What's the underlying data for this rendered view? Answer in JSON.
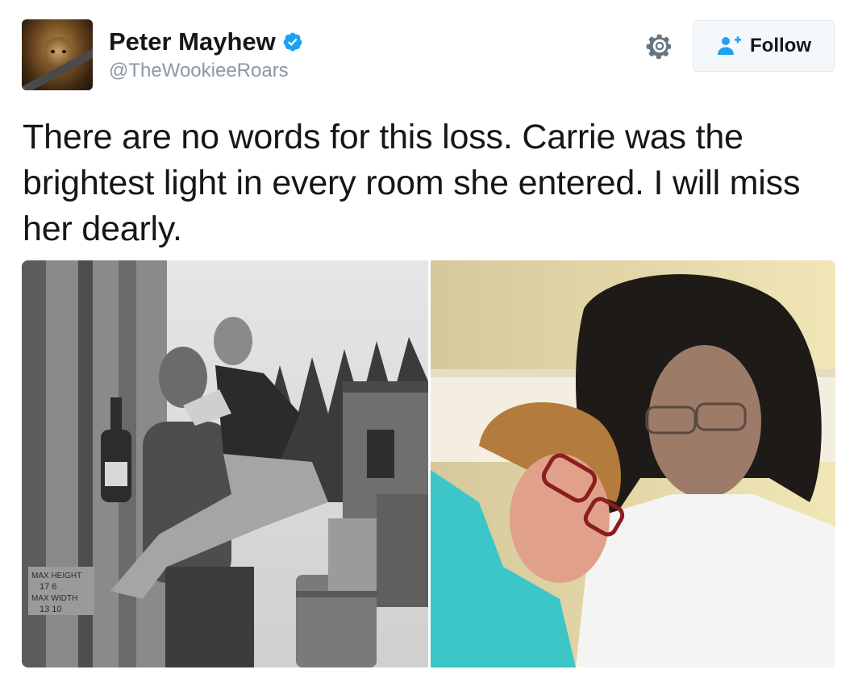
{
  "author": {
    "name": "Peter Mayhew",
    "handle": "@TheWookieeRoars",
    "verified": true
  },
  "actions": {
    "follow_label": "Follow",
    "settings_icon": "gear-icon",
    "follow_icon": "add-user-icon"
  },
  "tweet": {
    "text": "There are no words for this loss. Carrie was the brightest light in every room she entered. I will miss her dearly."
  },
  "photos": {
    "left_sign_lines": [
      "MAX HEIGHT",
      "17  6",
      "MAX WIDTH",
      "13  10"
    ]
  },
  "colors": {
    "verified_blue": "#1da1f2",
    "handle_gray": "#8899a6",
    "follow_icon_blue": "#1da1f2"
  }
}
